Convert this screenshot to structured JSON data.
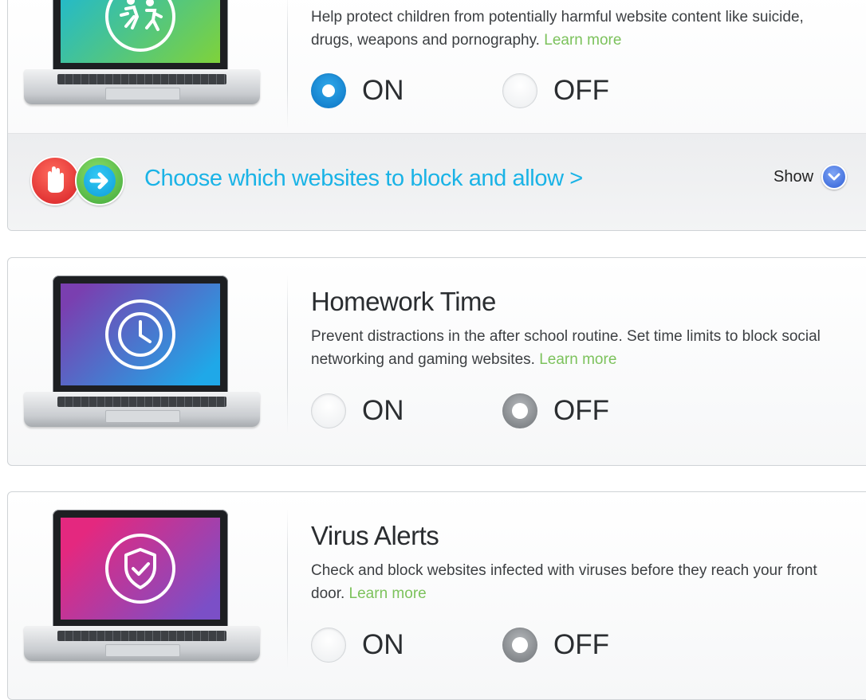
{
  "features": [
    {
      "title": "",
      "description": "Help protect children from potentially harmful website content like suicide, drugs, weapons and pornography.",
      "learn_more": "Learn more",
      "on_label": "ON",
      "off_label": "OFF",
      "selected": "ON",
      "screen_colors": [
        "#15b6e0",
        "#7fd23a"
      ],
      "icon": "running-children-icon"
    },
    {
      "title": "Homework Time",
      "description": "Prevent distractions in the after school routine. Set time limits to block social networking and gaming websites.",
      "learn_more": "Learn more",
      "on_label": "ON",
      "off_label": "OFF",
      "selected": "OFF",
      "screen_colors": [
        "#7a3fb0",
        "#1fa8e8"
      ],
      "icon": "clock-icon"
    },
    {
      "title": "Virus Alerts",
      "description": "Check and block websites infected with viruses before they reach your front door.",
      "learn_more": "Learn more",
      "on_label": "ON",
      "off_label": "OFF",
      "selected": "OFF",
      "screen_colors": [
        "#e4287f",
        "#7b4fc7"
      ],
      "icon": "shield-check-icon"
    }
  ],
  "chooser": {
    "link_text": "Choose which websites to block and allow >",
    "show_label": "Show",
    "icons": [
      "stop-hand-icon",
      "arrow-right-icon",
      "chevron-down-icon"
    ]
  },
  "colors": {
    "accent_blue": "#1ab3e6",
    "learn_more_green": "#7cc25c",
    "radio_on_blue": "#0b73c4"
  }
}
